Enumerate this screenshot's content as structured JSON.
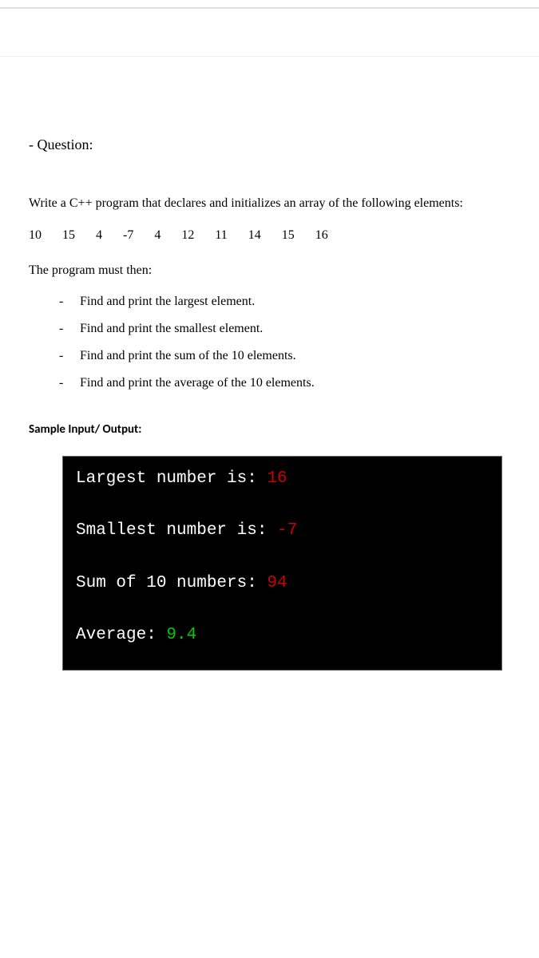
{
  "question": {
    "heading": "- Question:",
    "prompt": "Write a C++ program that declares and initializes an array of the following elements:",
    "array_elements": [
      "10",
      "15",
      "4",
      "-7",
      "4",
      "12",
      "11",
      "14",
      "15",
      "16"
    ],
    "then_label": "The program must then:",
    "tasks": [
      "Find and print the largest element.",
      "Find and print the smallest element.",
      "Find and print the sum of the 10 elements.",
      "Find and print the average of the 10 elements."
    ],
    "sample_heading": "Sample Input/ Output:"
  },
  "terminal": {
    "lines": [
      {
        "label": "Largest number is: ",
        "value": "16",
        "value_color": "red"
      },
      {
        "label": "Smallest number is: ",
        "value": "-7",
        "value_color": "red"
      },
      {
        "label": "Sum of 10 numbers: ",
        "value": "94",
        "value_color": "red"
      },
      {
        "label": "Average: ",
        "value": "9.4",
        "value_color": "green"
      }
    ]
  }
}
